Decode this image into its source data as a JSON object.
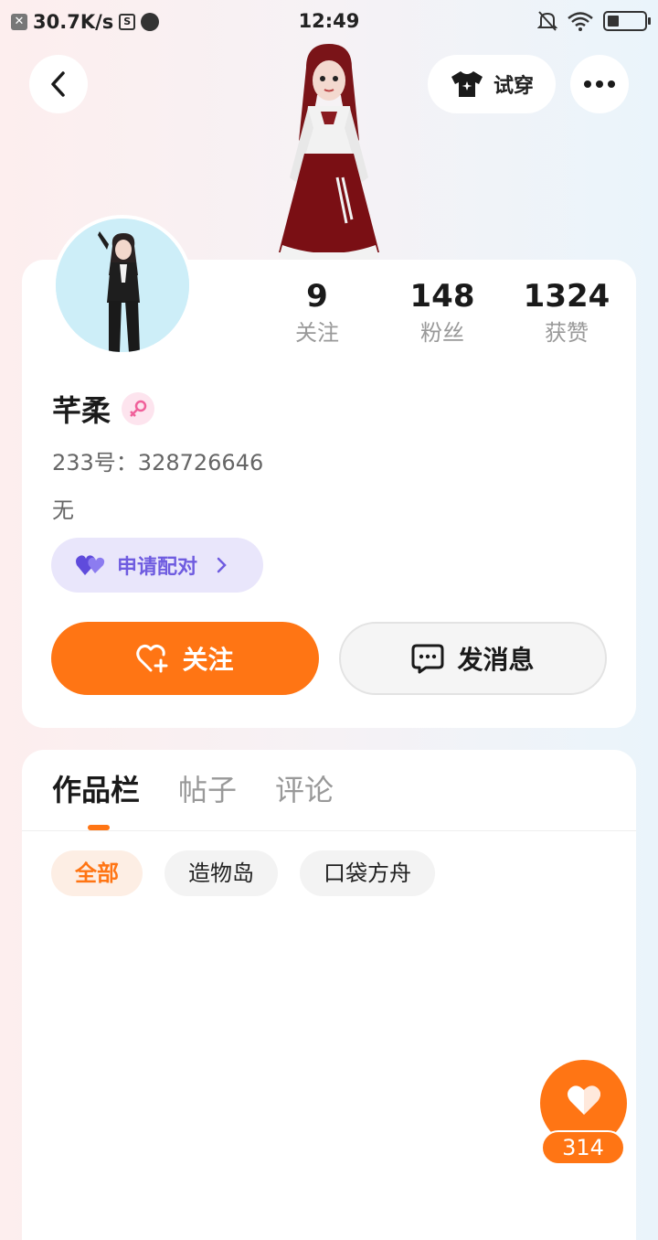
{
  "status_bar": {
    "net_speed": "30.7K/s",
    "time": "12:49"
  },
  "header": {
    "tryon_label": "试穿"
  },
  "profile": {
    "stats": [
      {
        "value": "9",
        "label": "关注"
      },
      {
        "value": "148",
        "label": "粉丝"
      },
      {
        "value": "1324",
        "label": "获赞"
      }
    ],
    "name": "芊柔",
    "uid": "233号：328726646",
    "bio": "无",
    "pair_label": "申请配对",
    "follow_label": "关注",
    "message_label": "发消息"
  },
  "content": {
    "tabs": [
      "作品栏",
      "帖子",
      "评论"
    ],
    "active_tab": 0,
    "chips": [
      "全部",
      "造物岛",
      "口袋方舟"
    ],
    "active_chip": 0
  },
  "like_fab": {
    "count": "314"
  },
  "colors": {
    "accent": "#ff7514",
    "pair": "#6f5ce0",
    "pair_bg": "#e9e6fb"
  }
}
